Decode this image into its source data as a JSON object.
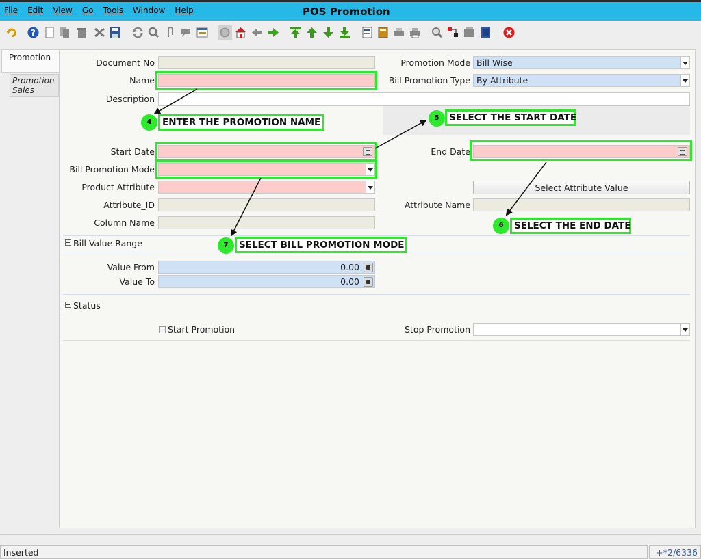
{
  "menu": {
    "file": "File",
    "edit": "Edit",
    "view": "View",
    "go": "Go",
    "tools": "Tools",
    "window": "Window",
    "help": "Help"
  },
  "app_title": "POS Promotion",
  "toolbar_icons": [
    "undo-icon",
    "help-icon",
    "new-record-icon",
    "copy-record-icon",
    "delete-icon",
    "delete-selection-icon",
    "save-icon",
    "refresh-icon",
    "find-icon",
    "attachment-icon",
    "chat-icon",
    "grid-toggle-icon",
    "history-icon",
    "home-icon",
    "back-icon",
    "forward-icon",
    "first-record-icon",
    "previous-record-icon",
    "next-record-icon",
    "last-record-icon",
    "report-icon",
    "archive-icon",
    "print-preview-icon",
    "print-icon",
    "zoom-across-icon",
    "workflow-icon",
    "request-icon",
    "product-info-icon",
    "exit-icon"
  ],
  "tabs": {
    "main": "Promotion",
    "sub": "Promotion Sales"
  },
  "form": {
    "document_no": {
      "label": "Document No",
      "value": ""
    },
    "name": {
      "label": "Name",
      "value": ""
    },
    "description": {
      "label": "Description",
      "value": ""
    },
    "promotion_mode": {
      "label": "Promotion Mode",
      "value": "Bill Wise"
    },
    "bill_promotion_type": {
      "label": "Bill Promotion Type",
      "value": "By Attribute"
    },
    "start_date": {
      "label": "Start Date",
      "value": ""
    },
    "end_date": {
      "label": "End Date",
      "value": ""
    },
    "bill_promotion_mode": {
      "label": "Bill Promotion Mode",
      "value": ""
    },
    "product_attribute": {
      "label": "Product Attribute",
      "value": ""
    },
    "select_attribute_value": "Select Attribute Value",
    "attribute_id": {
      "label": "Attribute_ID",
      "value": ""
    },
    "attribute_name": {
      "label": "Attribute Name",
      "value": ""
    },
    "column_name": {
      "label": "Column Name",
      "value": ""
    }
  },
  "bill_value_range": {
    "title": "Bill Value Range",
    "value_from": {
      "label": "Value From",
      "value": "0.00"
    },
    "value_to": {
      "label": "Value To",
      "value": "0.00"
    }
  },
  "status_section": {
    "title": "Status",
    "start_promotion": {
      "label": "Start Promotion",
      "checked": false
    },
    "stop_promotion": {
      "label": "Stop Promotion",
      "value": ""
    }
  },
  "annotations": [
    {
      "step": "4",
      "text": "ENTER THE PROMOTION NAME"
    },
    {
      "step": "5",
      "text": "SELECT THE START DATE"
    },
    {
      "step": "6",
      "text": "SELECT THE END DATE"
    },
    {
      "step": "7",
      "text": "SELECT BILL PROMOTION MODE"
    }
  ],
  "statusbar": {
    "message": "Inserted",
    "record_info": "+*2/6336"
  },
  "colors": {
    "title_bar": "#26b9e8",
    "mandatory": "#ffcccc",
    "read_only": "#ecebdf",
    "highlight": "#2ee82e"
  }
}
